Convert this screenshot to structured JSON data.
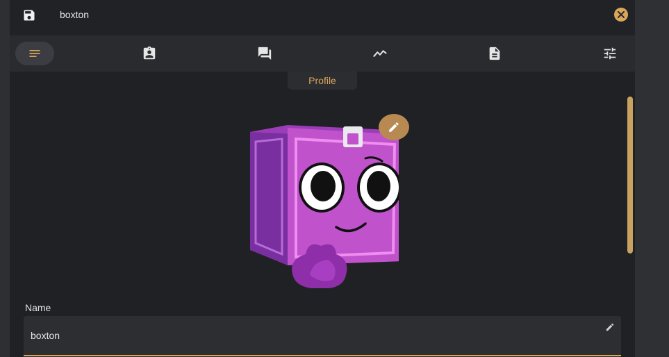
{
  "header": {
    "character_name": "boxton",
    "save_icon": "save-icon",
    "close_icon": "close-circle-icon"
  },
  "tabs": [
    {
      "icon": "notes-icon",
      "active": true
    },
    {
      "icon": "badge-clipboard-icon",
      "active": false
    },
    {
      "icon": "chat-icon",
      "active": false
    },
    {
      "icon": "trend-icon",
      "active": false
    },
    {
      "icon": "document-icon",
      "active": false
    },
    {
      "icon": "sliders-icon",
      "active": false
    }
  ],
  "tooltip": {
    "label": "Profile"
  },
  "avatar": {
    "edit_icon": "pencil-icon"
  },
  "name_field": {
    "label": "Name",
    "value": "boxton",
    "edit_icon": "pencil-icon"
  },
  "colors": {
    "accent": "#d9a65a",
    "background": "#202125",
    "avatar_purple": "#b24fc2"
  }
}
